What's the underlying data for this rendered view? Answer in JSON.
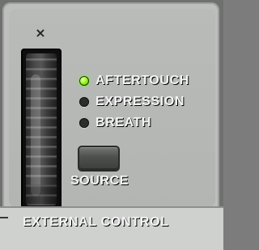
{
  "panel": {
    "x_label": "×",
    "section_label": "EXTERNAL CONTROL",
    "source_label": "SOURCE",
    "options": [
      {
        "label": "AFTERTOUCH",
        "state": "on"
      },
      {
        "label": "EXPRESSION",
        "state": "off"
      },
      {
        "label": "BREATH",
        "state": "off"
      }
    ],
    "icons": {
      "x_icon": "x-icon",
      "led_icon": "led-icon"
    },
    "colors": {
      "led_on": "#66d400",
      "led_off": "#2b2f2a"
    }
  }
}
